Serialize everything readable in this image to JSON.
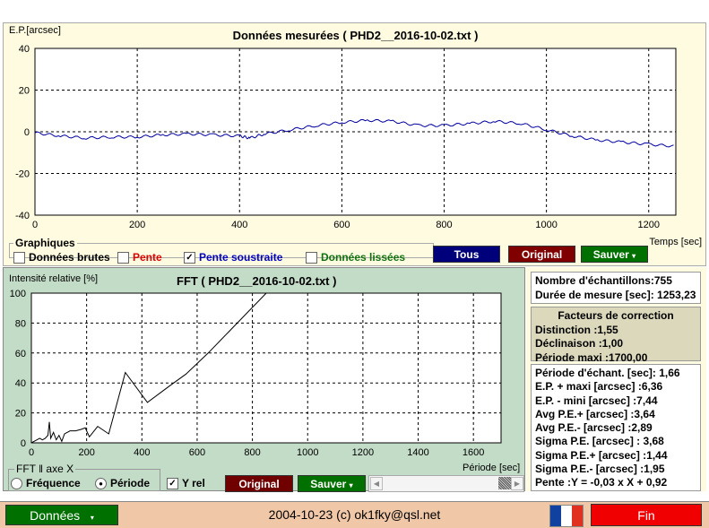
{
  "main_chart": {
    "title": "Données mesurées ( PHD2__2016-10-02.txt )",
    "ylabel": "E.P.[arcsec]",
    "xlabel": "Temps [sec]",
    "yticks": [
      "40",
      "20",
      "0",
      "-20",
      "-40"
    ],
    "xticks": [
      "0",
      "200",
      "400",
      "600",
      "800",
      "1000",
      "1200"
    ],
    "chart_data": {
      "type": "line",
      "xlim": [
        0,
        1253
      ],
      "ylim": [
        -40,
        40
      ],
      "series": [
        {
          "name": "Pente soustraite",
          "color": "#0000a0",
          "x": [
            0,
            50,
            100,
            150,
            200,
            250,
            300,
            350,
            400,
            420,
            450,
            500,
            550,
            600,
            650,
            700,
            750,
            800,
            850,
            900,
            950,
            1000,
            1050,
            1100,
            1150,
            1200,
            1253
          ],
          "y": [
            -0.5,
            -2,
            -3,
            -2.5,
            -2.5,
            -1.5,
            -1,
            -1.5,
            -2,
            -3,
            -1,
            1,
            3,
            4.5,
            5.5,
            5,
            3,
            3,
            4,
            5,
            4,
            1,
            -2,
            -4,
            -5,
            -6,
            -7
          ]
        }
      ]
    }
  },
  "graphiques": {
    "legend": "Graphiques",
    "donnees_brutes": "Données brutes",
    "pente": "Pente",
    "pente_soustraite": "Pente soustraite",
    "donnees_lissees": "Données lissées",
    "tous": "Tous",
    "original": "Original",
    "sauver": "Sauver"
  },
  "fft_chart": {
    "title": "FFT ( PHD2__2016-10-02.txt )",
    "ylabel": "Intensité relative [%]",
    "xlabel": "Période [sec]",
    "yticks": [
      "100",
      "80",
      "60",
      "40",
      "20",
      "0"
    ],
    "xticks": [
      "0",
      "200",
      "400",
      "600",
      "800",
      "1000",
      "1200",
      "1400",
      "1600"
    ],
    "chart_data": {
      "type": "line",
      "xlim": [
        0,
        1700
      ],
      "ylim": [
        0,
        100
      ],
      "series": [
        {
          "name": "FFT",
          "color": "#000000",
          "x": [
            0,
            10,
            20,
            30,
            40,
            50,
            60,
            65,
            70,
            80,
            90,
            100,
            110,
            120,
            140,
            160,
            180,
            195,
            210,
            240,
            280,
            340,
            420,
            500,
            560,
            640,
            850,
            1700
          ],
          "y": [
            0,
            1,
            2,
            3,
            2,
            3,
            5,
            14,
            3,
            7,
            2,
            5,
            1,
            6,
            8,
            8,
            9,
            10,
            4,
            11,
            6,
            47,
            27,
            38,
            46,
            60,
            100,
            100
          ]
        }
      ]
    }
  },
  "fft_controls": {
    "axe_legend": "FFT ‖ axe X",
    "frequence": "Fréquence",
    "periode": "Période",
    "yrel": "Y rel",
    "original": "Original",
    "sauver": "Sauver"
  },
  "info": {
    "nombre": "Nombre d'échantillons:755",
    "duree": "Durée de mesure [sec]: 1253,23"
  },
  "correction": {
    "title": "Facteurs de correction",
    "distinction": "Distinction :1,55",
    "declinaison": "Déclinaison :1,00",
    "periode_maxi": "Période maxi :1700,00"
  },
  "stats": [
    "Période d'échant. [sec]: 1,66",
    "E.P. + maxi [arcsec] :6,36",
    "E.P. - mini [arcsec] :7,44",
    "Avg P.E.+ [arcsec] :3,64",
    "Avg P.E.- [arcsec] :2,89",
    "Sigma P.E. [arcsec] : 3,68",
    "Sigma P.E.+ [arcsec] :1,44",
    "Sigma P.E.- [arcsec] :1,95",
    "Pente :Y = -0,03 x X + 0,92"
  ],
  "footer": {
    "donnees": "Données",
    "credits": "2004-10-23 (c) ok1fky@qsl.net",
    "fin": "Fin"
  }
}
